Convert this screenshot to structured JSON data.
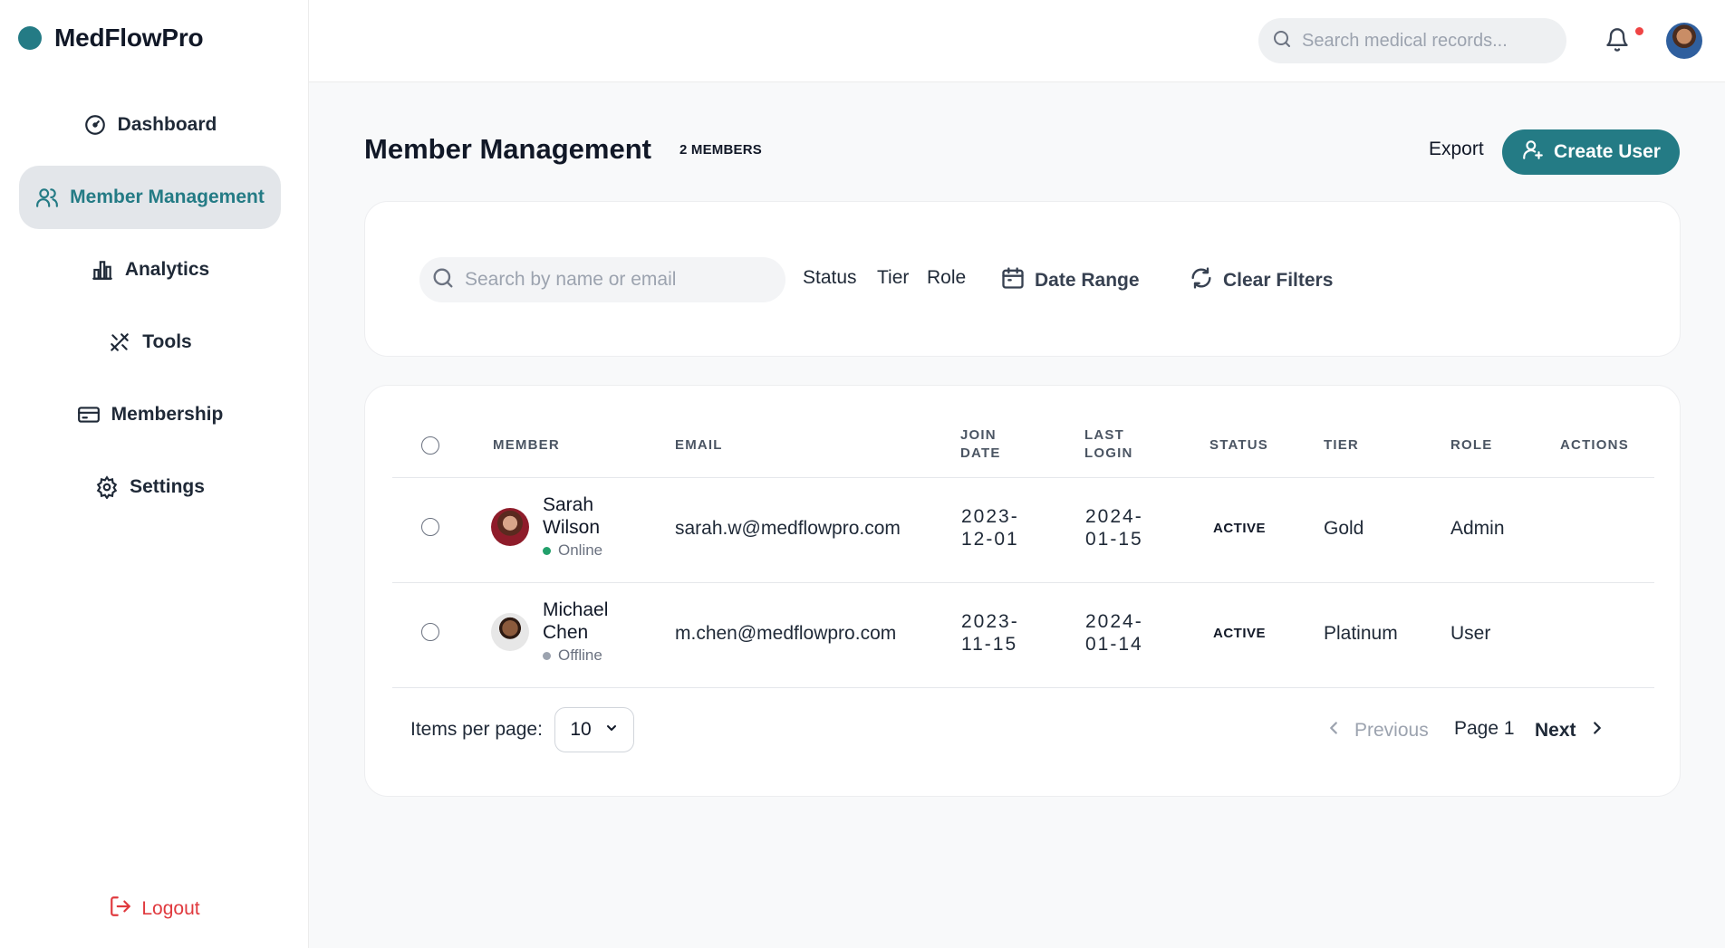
{
  "app": {
    "name": "MedFlowPro",
    "brand_color": "#247b85"
  },
  "sidebar": {
    "items": [
      {
        "label": "Dashboard",
        "icon": "gauge-icon"
      },
      {
        "label": "Member Management",
        "icon": "users-icon",
        "active": true
      },
      {
        "label": "Analytics",
        "icon": "bar-chart-icon"
      },
      {
        "label": "Tools",
        "icon": "tools-icon"
      },
      {
        "label": "Membership",
        "icon": "card-icon"
      },
      {
        "label": "Settings",
        "icon": "gear-icon"
      }
    ],
    "logout_label": "Logout"
  },
  "topbar": {
    "search_placeholder": "Search medical records...",
    "has_notification": true
  },
  "header": {
    "title": "Member Management",
    "count_badge": "2 MEMBERS",
    "export_label": "Export",
    "create_label": "Create User"
  },
  "filters": {
    "search_placeholder": "Search by name or email",
    "status_label": "Status",
    "tier_label": "Tier",
    "role_label": "Role",
    "date_range_label": "Date Range",
    "clear_label": "Clear Filters"
  },
  "table": {
    "columns": {
      "member": "MEMBER",
      "email": "EMAIL",
      "join_date_1": "JOIN",
      "join_date_2": "DATE",
      "last_login_1": "LAST",
      "last_login_2": "LOGIN",
      "status": "STATUS",
      "tier": "TIER",
      "role": "ROLE",
      "actions": "ACTIONS"
    },
    "rows": [
      {
        "first_name": "Sarah",
        "last_name": "Wilson",
        "presence": "Online",
        "presence_color": "#22a06b",
        "email": "sarah.w@medflowpro.com",
        "join_1": "2023-",
        "join_2": "12-01",
        "login_1": "2024-",
        "login_2": "01-15",
        "status": "ACTIVE",
        "tier": "Gold",
        "role": "Admin"
      },
      {
        "first_name": "Michael",
        "last_name": "Chen",
        "presence": "Offline",
        "presence_color": "#9ca3af",
        "email": "m.chen@medflowpro.com",
        "join_1": "2023-",
        "join_2": "11-15",
        "login_1": "2024-",
        "login_2": "01-14",
        "status": "ACTIVE",
        "tier": "Platinum",
        "role": "User"
      }
    ]
  },
  "pagination": {
    "items_per_page_label": "Items per page:",
    "items_per_page_value": "10",
    "previous_label": "Previous",
    "page_label": "Page 1",
    "next_label": "Next"
  }
}
